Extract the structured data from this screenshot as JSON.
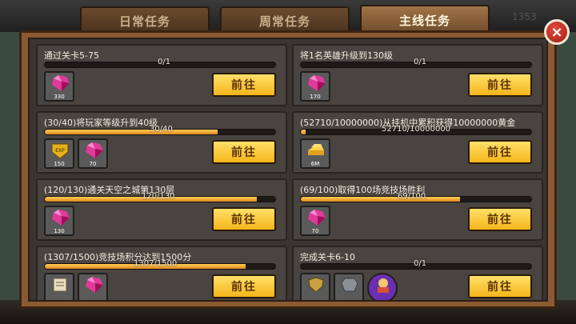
{
  "tabs": [
    {
      "label": "日常任务",
      "active": false
    },
    {
      "label": "周常任务",
      "active": false
    },
    {
      "label": "主线任务",
      "active": true
    }
  ],
  "close_label": "×",
  "go_label": "前往",
  "quests": [
    {
      "title": "通过关卡5-75",
      "progress_text": "0/1",
      "progress": 0.0,
      "rewards": [
        {
          "icon": "gem-icon",
          "count": "330"
        }
      ]
    },
    {
      "title": "将1名英雄升级到130级",
      "progress_text": "0/1",
      "progress": 0.0,
      "rewards": [
        {
          "icon": "gem-icon",
          "count": "170"
        }
      ]
    },
    {
      "title": "(30/40)将玩家等级升到40级",
      "progress_text": "30/40",
      "progress": 0.75,
      "rewards": [
        {
          "icon": "exp-icon",
          "count": "150"
        },
        {
          "icon": "gem-icon",
          "count": "70"
        }
      ]
    },
    {
      "title": "(52710/10000000)从挂机中累积获得10000000黄金",
      "progress_text": "52710/10000000",
      "progress": 0.005,
      "rewards": [
        {
          "icon": "gold-bar-icon",
          "count": "6M"
        }
      ]
    },
    {
      "title": "(120/130)通关天空之城第130层",
      "progress_text": "120/130",
      "progress": 0.92,
      "rewards": [
        {
          "icon": "gem-icon",
          "count": "130"
        }
      ]
    },
    {
      "title": "(69/100)取得100场竞技场胜利",
      "progress_text": "69/100",
      "progress": 0.69,
      "rewards": [
        {
          "icon": "gem-icon",
          "count": "70"
        }
      ]
    },
    {
      "title": "(1307/1500)竞技场积分达到1500分",
      "progress_text": "1307/1500",
      "progress": 0.87,
      "rewards": [
        {
          "icon": "scroll-icon",
          "count": ""
        },
        {
          "icon": "gem-icon",
          "count": ""
        }
      ]
    },
    {
      "title": "完成关卡6-10",
      "progress_text": "0/1",
      "progress": 0.0,
      "rewards": [
        {
          "icon": "shield-icon",
          "count": ""
        },
        {
          "icon": "armor-icon",
          "count": ""
        },
        {
          "icon": "hero-portrait-icon",
          "count": ""
        }
      ]
    }
  ],
  "background": {
    "top_right_number": "1353"
  }
}
